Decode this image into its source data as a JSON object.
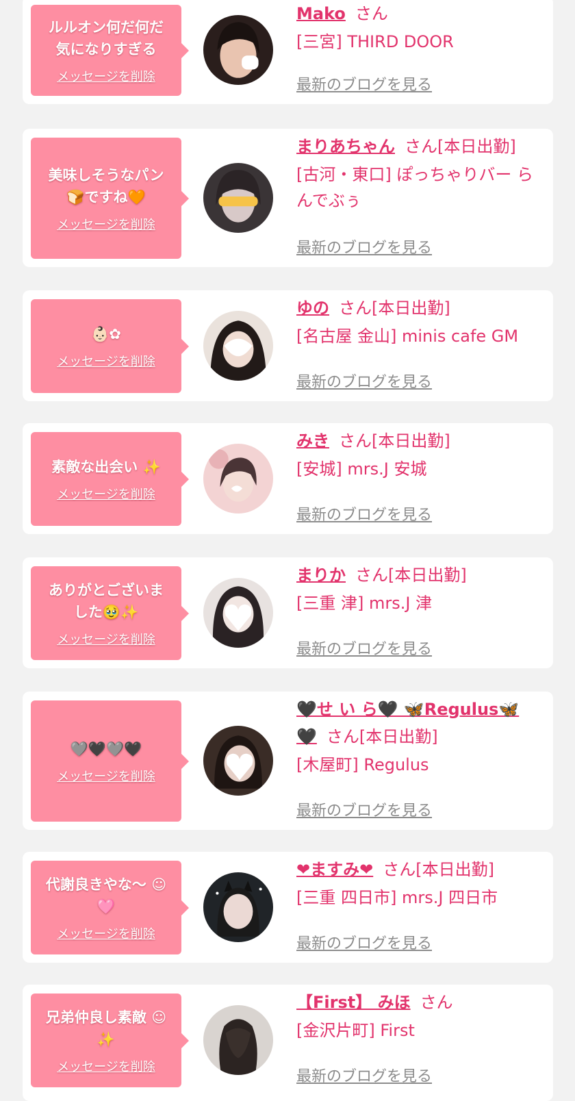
{
  "colors": {
    "background": "#f2f2f2",
    "card": "#ffffff",
    "bubble": "#fe8ea2",
    "name_accent": "#e2336c",
    "link_gray": "#8c8c8c"
  },
  "delete_label": "メッセージを削除",
  "blog_label": "最新のブログを見る",
  "entries": [
    {
      "message": "ルルオン何だ何だ\n気になりすぎる",
      "name": "Mako",
      "suffix": "さん",
      "shop": "[三宮] THIRD DOOR",
      "avatar_icon": "woman-portrait-avatar"
    },
    {
      "message": "美味しそうなパン\n🍞ですね🧡",
      "name": "まりあちゃん",
      "suffix": "さん[本日出勤]",
      "shop": "[古河・東口] ぽっちゃりバー らんでぶぅ",
      "avatar_icon": "woman-portrait-avatar"
    },
    {
      "message": "👶🏻✿",
      "name": "ゆの",
      "suffix": "さん[本日出勤]",
      "shop": "[名古屋 金山] minis cafe GM",
      "avatar_icon": "woman-portrait-avatar"
    },
    {
      "message": "素敵な出会い ✨",
      "name": "みき",
      "suffix": "さん[本日出勤]",
      "shop": "[安城] mrs.J 安城",
      "avatar_icon": "woman-portrait-avatar"
    },
    {
      "message": "ありがとございま\nした🥹✨",
      "name": "まりか",
      "suffix": "さん[本日出勤]",
      "shop": "[三重 津] mrs.J 津",
      "avatar_icon": "woman-portrait-avatar"
    },
    {
      "message": "🩶🖤🩶🖤",
      "name": "🖤せ い ら🖤 🦋Regulus🦋 🖤",
      "suffix": "さん[本日出勤]",
      "shop": "[木屋町] Regulus",
      "avatar_icon": "woman-portrait-avatar"
    },
    {
      "message": "代謝良きやな〜 ☺\n🩷",
      "name": "❤ますみ❤",
      "suffix": "さん[本日出勤]",
      "shop": "[三重 四日市] mrs.J 四日市",
      "avatar_icon": "woman-portrait-avatar"
    },
    {
      "message": "兄弟仲良し素敵 ☺\n✨",
      "name": "【First】 みほ",
      "suffix": "さん",
      "shop": "[金沢片町] First",
      "avatar_icon": "woman-portrait-avatar"
    }
  ]
}
